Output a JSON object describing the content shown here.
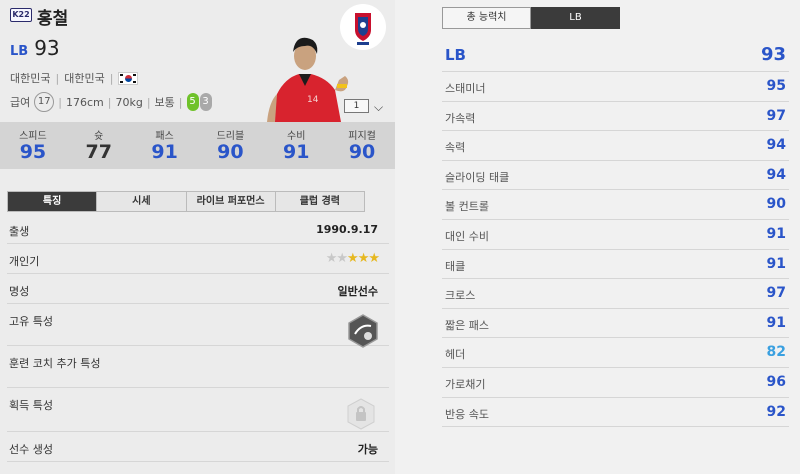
{
  "player": {
    "season_badge": "K22",
    "name": "홍철",
    "position": "LB",
    "overall": "93",
    "nation_1": "대한민국",
    "nation_2": "대한민국",
    "flag_icon": "south-korea-flag-icon",
    "wage_label": "급여",
    "wage_value": "17",
    "height": "176cm",
    "weight": "70kg",
    "body_type": "보통",
    "weak_foot_left": "5",
    "weak_foot_right": "3",
    "level": "1"
  },
  "stats": [
    {
      "label": "스피드",
      "value": "95"
    },
    {
      "label": "슛",
      "value": "77"
    },
    {
      "label": "패스",
      "value": "91"
    },
    {
      "label": "드리블",
      "value": "90"
    },
    {
      "label": "수비",
      "value": "91"
    },
    {
      "label": "피지컬",
      "value": "90"
    }
  ],
  "tabs": [
    "특징",
    "시세",
    "라이브 퍼포먼스",
    "클럽 경력"
  ],
  "details": {
    "birth_label": "출생",
    "birth_value": "1990.9.17",
    "skill_label": "개인기",
    "skill_stars_filled": 3,
    "skill_stars_total": 5,
    "fame_label": "명성",
    "fame_value": "일반선수",
    "trait_label": "고유 특성",
    "coach_label": "훈련 코치 추가 특성",
    "acquired_label": "획득 특성",
    "create_label": "선수 생성",
    "create_value": "가능"
  },
  "right_tabs": [
    "총 능력치",
    "LB"
  ],
  "ratings": {
    "head_label": "LB",
    "head_value": "93",
    "rows": [
      {
        "label": "스태미너",
        "value": "95"
      },
      {
        "label": "가속력",
        "value": "97"
      },
      {
        "label": "속력",
        "value": "94"
      },
      {
        "label": "슬라이딩 태클",
        "value": "94"
      },
      {
        "label": "볼 컨트롤",
        "value": "90"
      },
      {
        "label": "대인 수비",
        "value": "91"
      },
      {
        "label": "태클",
        "value": "91"
      },
      {
        "label": "크로스",
        "value": "97"
      },
      {
        "label": "짧은 패스",
        "value": "91"
      },
      {
        "label": "헤더",
        "value": "82"
      },
      {
        "label": "가로채기",
        "value": "96"
      },
      {
        "label": "반응 속도",
        "value": "92"
      }
    ]
  },
  "colors": {
    "accent_blue": "#2a55c9",
    "light_blue": "#3aa0e0",
    "dark_tab": "#3b3b3b"
  }
}
